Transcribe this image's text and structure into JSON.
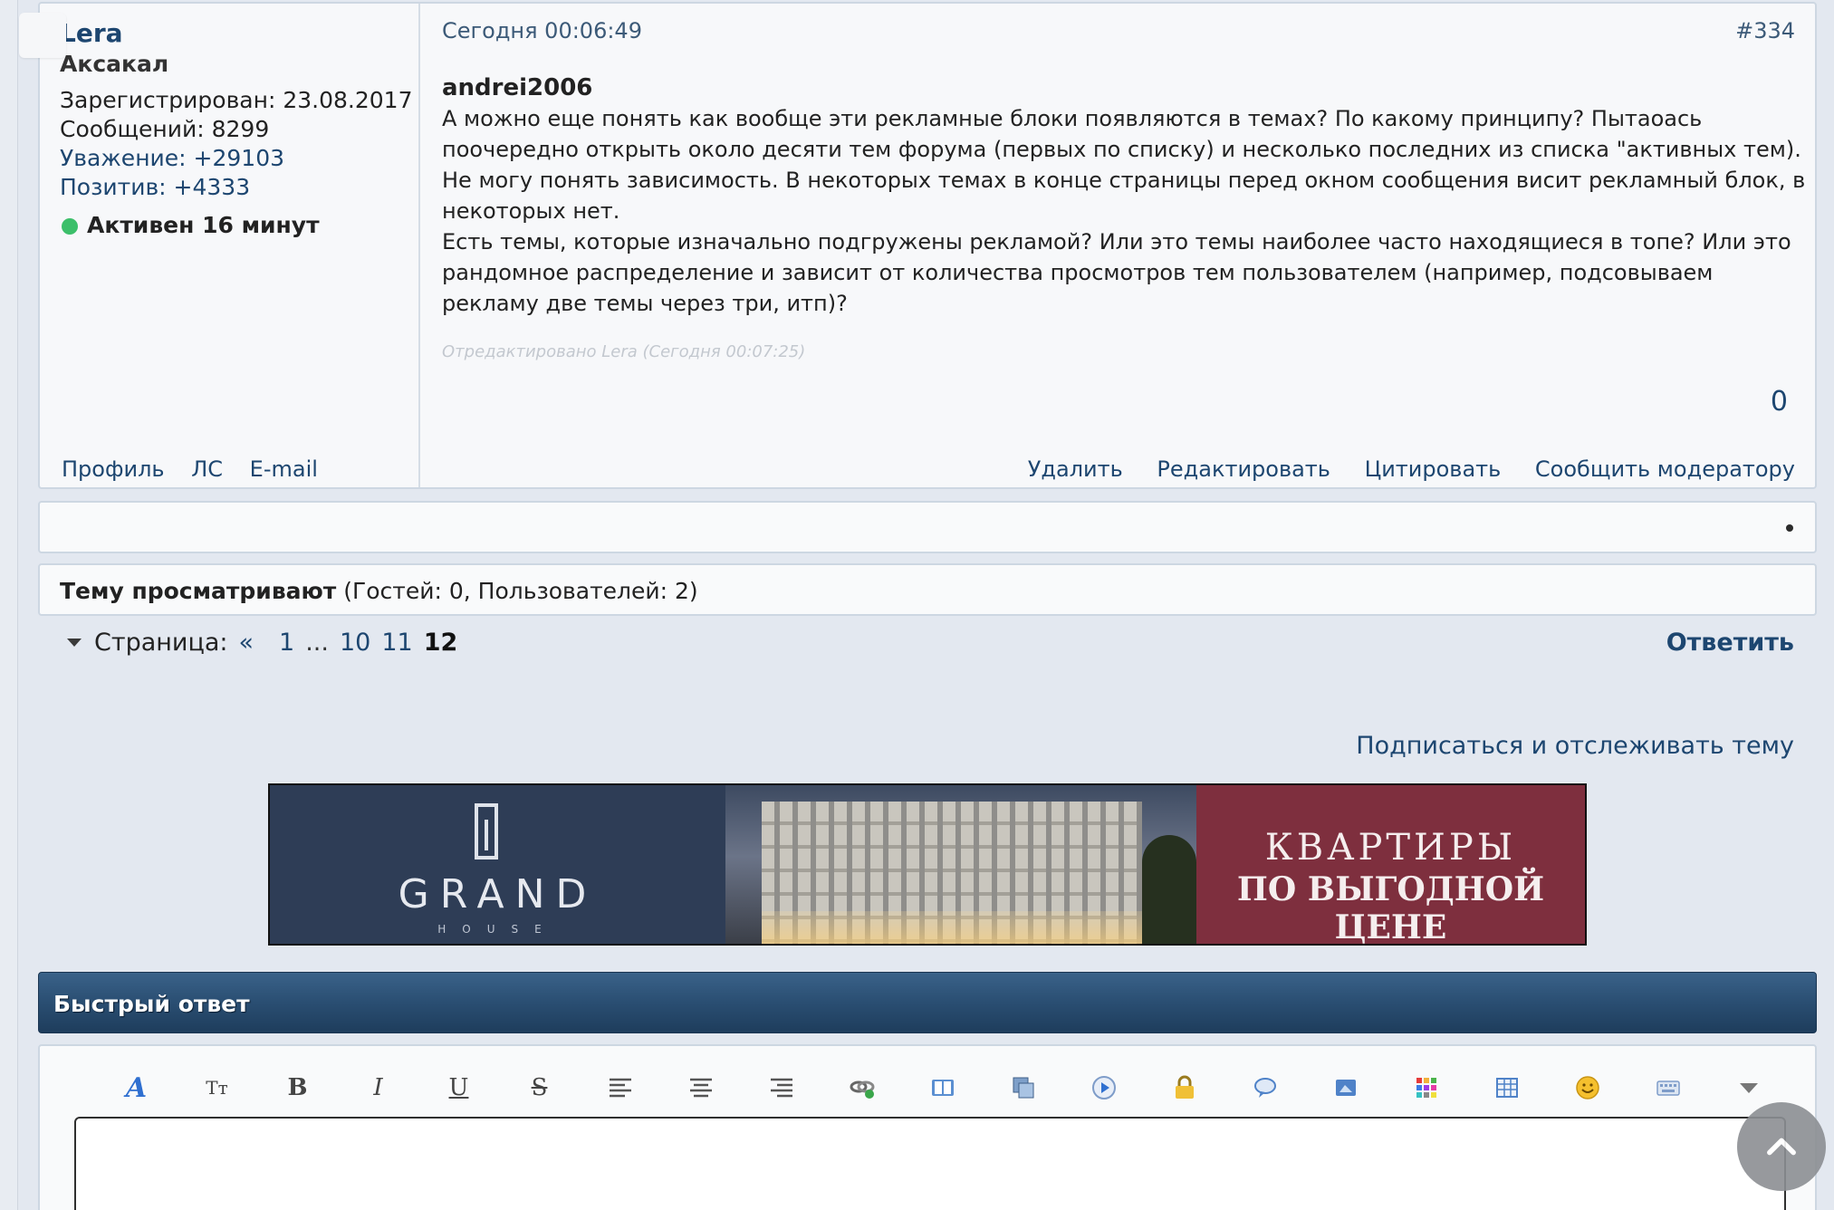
{
  "post": {
    "username": "Lera",
    "user_title": "Аксакал",
    "registered": "Зарегистрирован: 23.08.2017",
    "messages": "Сообщений: 8299",
    "respect": "Уважение: +29103",
    "positive": "Позитив: +4333",
    "online_status": "Активен 16 минут",
    "user_links": [
      "Профиль",
      "ЛС",
      "E-mail"
    ],
    "date": "Сегодня 00:06:49",
    "number": "#334",
    "quote_author": "andrei2006",
    "text_p1": "А можно еще понять как вообще эти рекламные блоки появляются в темах? По какому принципу? Пытаоась поочередно открыть около десяти тем форума (первых по списку) и несколько последних из списка \"активных тем). Не могу понять зависимость. В некоторых темах в конце страницы перед окном сообщения висит рекламный блок, в некоторых нет.",
    "text_p2": "Есть темы, которые изначально подгружены рекламой? Или это темы наиболее часто находящиеся в топе? Или это рандомное распределение и зависит от количества просмотров тем пользователем (например, подсовываем рекламу две темы через три, итп)?",
    "edited": "Отредактировано Lera (Сегодня 00:07:25)",
    "likes": "0",
    "actions": [
      "Удалить",
      "Редактировать",
      "Цитировать",
      "Сообщить модератору"
    ]
  },
  "viewers": {
    "label": "Тему просматривают",
    "detail": " (Гостей: 0, Пользователей: 2)"
  },
  "pagination": {
    "label": "Страница:",
    "prev": "«",
    "pages": [
      "1",
      "...",
      "10",
      "11"
    ],
    "current": "12"
  },
  "reply_label": "Ответить",
  "subscribe_label": "Подписаться и отслеживать тему",
  "banner": {
    "brand": "GRAND",
    "brand_sub": "HOUSE",
    "line1": "КВАРТИРЫ",
    "line2": "ПО ВЫГОДНОЙ ЦЕНЕ"
  },
  "quick_reply": {
    "title": "Быстрый ответ",
    "toolbar_icons": [
      "font-color-icon",
      "font-size-icon",
      "bold-icon",
      "italic-icon",
      "underline-icon",
      "strikethrough-icon",
      "align-left-icon",
      "align-center-icon",
      "align-right-icon",
      "link-icon",
      "book-icon",
      "copy-icon",
      "play-icon",
      "lock-icon",
      "speech-bubble-icon",
      "image-icon",
      "color-grid-icon",
      "table-icon",
      "smiley-icon",
      "keyboard-icon",
      "dropdown-icon"
    ]
  },
  "colors": {
    "accent": "#1d4670",
    "header_bar": "#2a4e72",
    "online": "#3cbf6a",
    "banner_red": "#7e2f3e",
    "banner_navy": "#2e3d56"
  }
}
